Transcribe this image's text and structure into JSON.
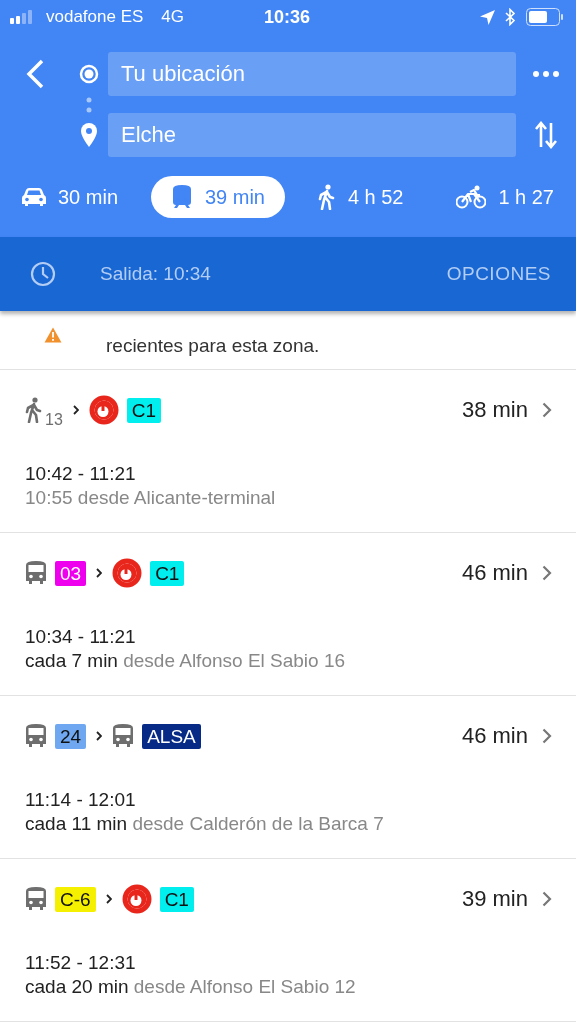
{
  "status_bar": {
    "carrier": "vodafone ES",
    "network": "4G",
    "time": "10:36"
  },
  "directions": {
    "origin": "Tu ubicación",
    "destination": "Elche"
  },
  "modes": [
    {
      "kind": "car",
      "duration": "30 min",
      "selected": false
    },
    {
      "kind": "transit",
      "duration": "39 min",
      "selected": true
    },
    {
      "kind": "walk",
      "duration": "4 h 52",
      "selected": false
    },
    {
      "kind": "bike",
      "duration": "1 h 27",
      "selected": false
    }
  ],
  "departure": {
    "label": "Salida: 10:34",
    "options": "OPCIONES"
  },
  "notice": {
    "text": "recientes para esta zona."
  },
  "routes": [
    {
      "legs": [
        {
          "kind": "walk",
          "minutes": "13"
        },
        {
          "kind": "train",
          "line": "C1",
          "color": "#00eeee"
        }
      ],
      "duration": "38 min",
      "times": "10:42 - 11:21",
      "origin": "10:55 desde Alicante-terminal"
    },
    {
      "legs": [
        {
          "kind": "bus",
          "line": "03",
          "color": "#ee00ee"
        },
        {
          "kind": "train",
          "line": "C1",
          "color": "#00eeee"
        }
      ],
      "duration": "46 min",
      "times": "10:34 - 11:21",
      "frequency": "cada 7 min",
      "origin": "desde Alfonso El Sabio 16"
    },
    {
      "legs": [
        {
          "kind": "bus",
          "line": "24",
          "color": "#6fa8f0"
        },
        {
          "kind": "bus",
          "line": "ALSA",
          "color": "#062a86"
        }
      ],
      "duration": "46 min",
      "times": "11:14 - 12:01",
      "frequency": "cada 11 min",
      "origin": "desde Calderón de la Barca 7"
    },
    {
      "legs": [
        {
          "kind": "bus",
          "line": "C-6",
          "color": "#f5f000"
        },
        {
          "kind": "train",
          "line": "C1",
          "color": "#00eeee"
        }
      ],
      "duration": "39 min",
      "times": "11:52 - 12:31",
      "frequency": "cada 20 min",
      "origin": "desde Alfonso El Sabio 12"
    }
  ]
}
